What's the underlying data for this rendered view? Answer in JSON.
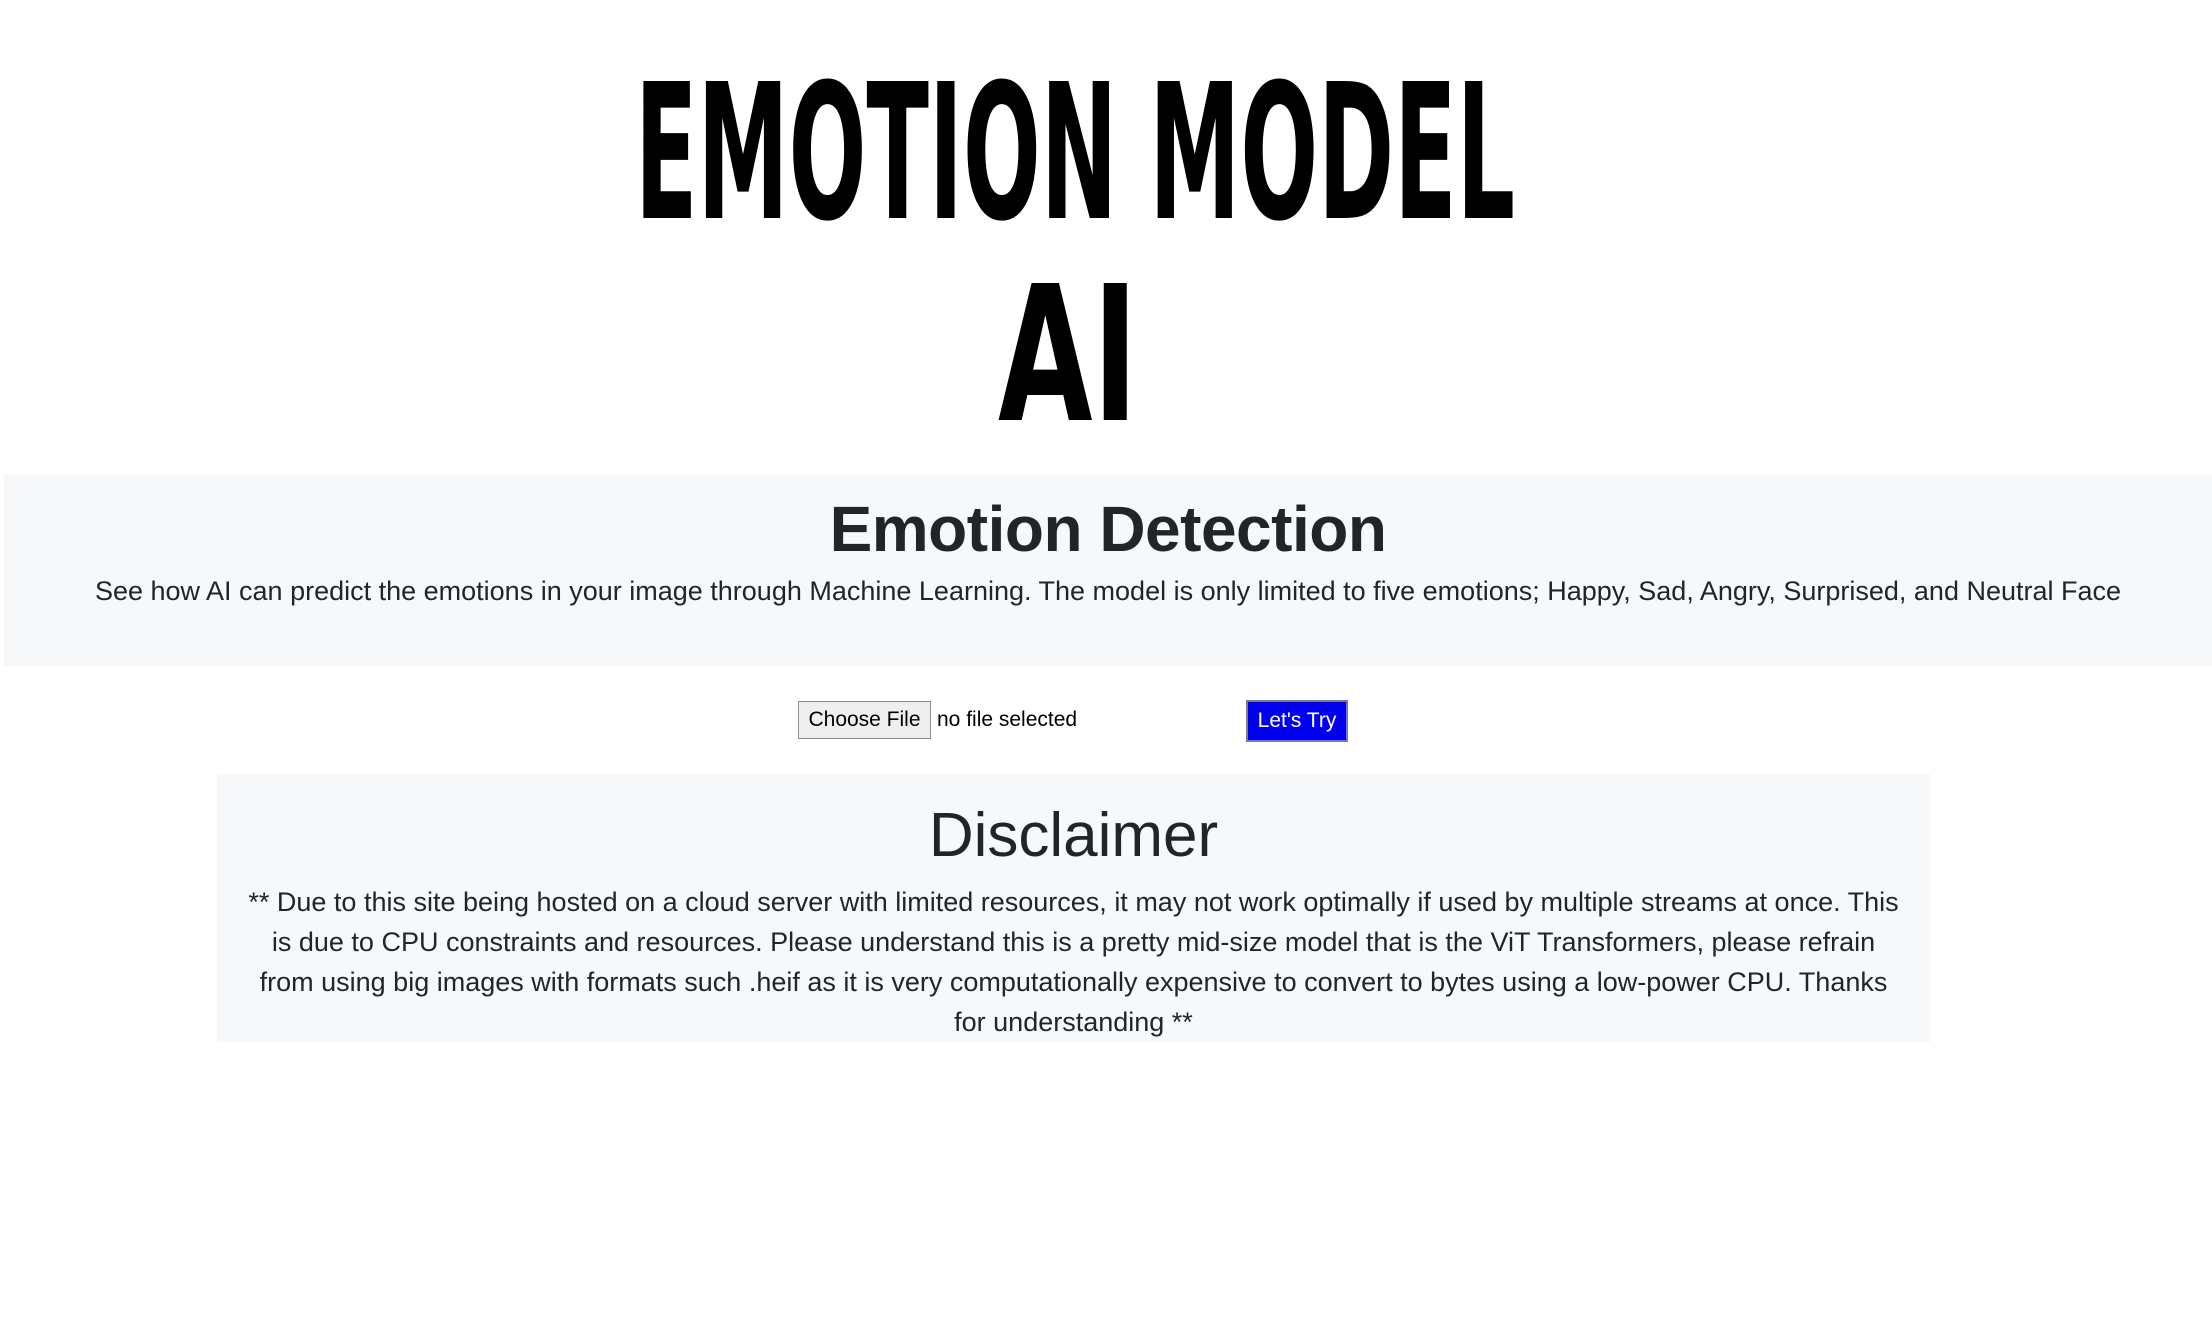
{
  "logo": {
    "line1": "EMOTION MODEL",
    "line2": "AI"
  },
  "hero": {
    "title": "Emotion Detection",
    "description": "See how AI can predict the emotions in your image through Machine Learning. The model is only limited to five emotions; Happy, Sad, Angry, Surprised, and Neutral Face"
  },
  "upload": {
    "choose_label": "Choose File",
    "status_text": "no file selected",
    "submit_label": "Let's Try"
  },
  "disclaimer": {
    "title": "Disclaimer",
    "body": "** Due to this site being hosted on a cloud server with limited resources, it may not work optimally if used by multiple streams at once. This is due to CPU constraints and resources. Please understand this is a pretty mid-size model that is the ViT Transformers, please refrain from using big images with formats such .heif as it is very computationally expensive to convert to bytes using a low-power CPU. Thanks for understanding **"
  },
  "colors": {
    "section_bg": "#f7f8fa",
    "submit_bg": "#0000ee",
    "text": "#212529"
  }
}
